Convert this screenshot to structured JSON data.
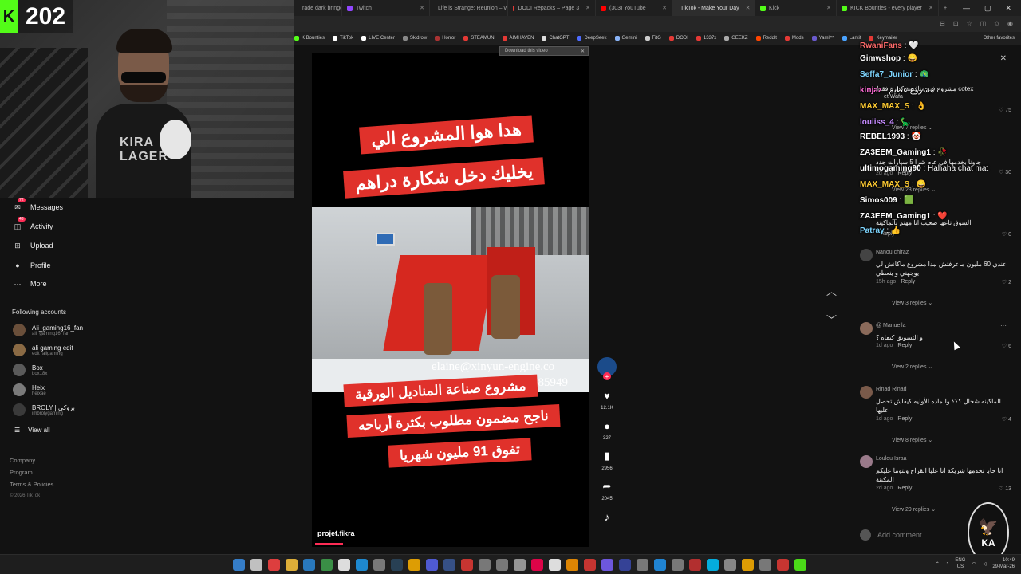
{
  "stream": {
    "viewer_count": "202",
    "shirt_text": "KIRA LAGER"
  },
  "browser": {
    "tabs": [
      {
        "label": "rade dark bringe",
        "color": "#6b8bd6",
        "active": false
      },
      {
        "label": "Twitch",
        "color": "#9146ff",
        "active": false
      },
      {
        "label": "Life is Strange: Reunion – v1",
        "color": "#e05b9a",
        "active": false
      },
      {
        "label": "DODI Repacks – Page 3",
        "color": "#e53935",
        "active": false
      },
      {
        "label": "(303) YouTube",
        "color": "#ff0000",
        "active": false
      },
      {
        "label": "TikTok - Make Your Day",
        "color": "#ffffff",
        "active": true
      },
      {
        "label": "Kick",
        "color": "#53fc18",
        "active": false
      },
      {
        "label": "KICK Bounties - every player",
        "color": "#53fc18",
        "active": false
      }
    ],
    "new_tab": "+",
    "bookmarks": [
      {
        "label": "K Bounties",
        "color": "#53fc18"
      },
      {
        "label": "TikTok",
        "color": "#ffffff"
      },
      {
        "label": "LIVE Center",
        "color": "#ffffff"
      },
      {
        "label": "Skidrow",
        "color": "#888888"
      },
      {
        "label": "Horror",
        "color": "#aa3333"
      },
      {
        "label": "STEAMUN",
        "color": "#e53935"
      },
      {
        "label": "AIMHAVEN",
        "color": "#e53935"
      },
      {
        "label": "ChatGPT",
        "color": "#dddddd"
      },
      {
        "label": "DeepSeek",
        "color": "#4d6bfe"
      },
      {
        "label": "Gemini",
        "color": "#8ab4f8"
      },
      {
        "label": "FitG",
        "color": "#cccccc"
      },
      {
        "label": "DODI",
        "color": "#e53935"
      },
      {
        "label": "1337x",
        "color": "#e53935"
      },
      {
        "label": "GEEKZ",
        "color": "#aaaaaa"
      },
      {
        "label": "Reddit",
        "color": "#ff4500"
      },
      {
        "label": "Mods",
        "color": "#e53935"
      },
      {
        "label": "Yaml™",
        "color": "#6a5acd"
      },
      {
        "label": "Larkit",
        "color": "#4aa3ff"
      },
      {
        "label": "Keymailer",
        "color": "#e53935"
      }
    ],
    "other_bookmarks": "Other favorites"
  },
  "sidebar": {
    "nav": [
      {
        "label": "Messages",
        "badge": "72",
        "icon": "✉"
      },
      {
        "label": "Activity",
        "badge": "43",
        "icon": "◫"
      },
      {
        "label": "Upload",
        "badge": "",
        "icon": "⊞"
      },
      {
        "label": "Profile",
        "badge": "",
        "icon": "●"
      },
      {
        "label": "More",
        "badge": "",
        "icon": "···"
      }
    ],
    "following_title": "Following accounts",
    "accounts": [
      {
        "name": "Ali_gaming16_fan",
        "handle": "ali_gaming16_fan"
      },
      {
        "name": "ali gaming edit",
        "handle": "edit_aligaming"
      },
      {
        "name": "Box",
        "handle": "box18x"
      },
      {
        "name": "Heix",
        "handle": "heixae"
      },
      {
        "name": "BROLY | بروكي",
        "handle": "imbrolygaming"
      }
    ],
    "view_all": "View all",
    "footer": [
      "Company",
      "Program",
      "Terms & Policies"
    ],
    "copyright": "© 2026 TikTok"
  },
  "video": {
    "download_bar": "Download this video",
    "caption_1": "هدا هوا المشروع الي",
    "caption_2": "يخليك دخل شكارة دراهم",
    "email": "elaine@xinyun-engine.co",
    "phone": "685949",
    "caption_3": "مشروع صناعة المناديل الورقية",
    "caption_4": "ناجح مضمون مطلوب بكثرة أرباحه",
    "caption_5": "تفوق 91 مليون شهريا",
    "author": "projet.fikra",
    "progress_fraction": 0.1
  },
  "actions": {
    "likes": "12.1K",
    "comments": "327",
    "saves": "2956",
    "shares": "2045"
  },
  "comments": [
    {
      "name": "Nanou chiraz",
      "text": "عندي 60 مليون ماعرفتش نبدا مشروع ماكانش لي يوجهني و ينعطي",
      "time": "15h ago",
      "likes": "2",
      "replies": "View 3 replies"
    },
    {
      "name": "@ Manuella",
      "text": "و التسويق كيفاه ؟",
      "time": "1d ago",
      "likes": "6",
      "replies": "View 2 replies"
    },
    {
      "name": "Rinad Rinad",
      "text": "الماكينه شحال ؟؟؟ والماده الأوليه كيفاش تحصل عليها",
      "time": "1d ago",
      "likes": "4",
      "replies": "View 8 replies"
    },
    {
      "name": "Loulou Israa",
      "text": "انا حابا نخدمها شريكة انا عليا القراج ونتوما عليكم المكينة",
      "time": "2d ago",
      "likes": "13",
      "replies": "View 29 replies"
    }
  ],
  "reply_label": "Reply",
  "add_comment_placeholder": "Add comment...",
  "chat": [
    {
      "user": "RwaniFans",
      "msg": " : 🤍",
      "color": "#ff6b6b"
    },
    {
      "user": "Gimwshop",
      "msg": " : 😄",
      "color": "#ffffff"
    },
    {
      "user": "Seffa7_Junior",
      "msg": " : 🦚",
      "color": "#7fd6ff"
    },
    {
      "user": "kinjaz",
      "msg": " : مشروع عظيم",
      "color": "#ff6bd6"
    },
    {
      "user": "MAX_MAX_S",
      "msg": " : 👌",
      "color": "#ffcc33"
    },
    {
      "user": "louiiss_4",
      "msg": " : 🦕",
      "color": "#c58bff"
    },
    {
      "user": "REBEL1993",
      "msg": " : 🤡",
      "color": "#ffffff"
    },
    {
      "user": "ZA3EEM_Gaming1",
      "msg": " : 🥀",
      "color": "#ffffff"
    },
    {
      "user": "ultimogaming90",
      "msg": " : Hahaha chat mat",
      "color": "#ffffff"
    },
    {
      "user": "MAX_MAX_S",
      "msg": " : 😄",
      "color": "#ffcc33"
    },
    {
      "user": "Simos009",
      "msg": " : 🟩",
      "color": "#ffffff"
    },
    {
      "user": "ZA3EEM_Gaming1",
      "msg": " : ❤️",
      "color": "#ffffff"
    },
    {
      "user": "Patray",
      "msg": " : 👍",
      "color": "#7fd6ff"
    }
  ],
  "chat_bg": {
    "c1_text": "cotex مشروع فيه منافسة كبيرة فقط",
    "c1_sub": "et Wafa",
    "c1_likes": "75",
    "c1_replies": "View 7 replies",
    "c2_text": "جاونا بخدمها في عام شرا 5 سيارات جدد",
    "c2_time": "2d ago",
    "c2_likes": "30",
    "c2_replies": "View 23 replies",
    "c3_text": "السوق تاعها صعيب انا مهتم بالماكينة",
    "c3_likes": "0"
  },
  "taskbar": {
    "icons": [
      "#3a8ee6",
      "#dddddd",
      "#ff4444",
      "#ffc83d",
      "#2b88d8",
      "#3fa34d",
      "#ffffff",
      "#1e9cf0",
      "#888888",
      "#2a475e",
      "#ffb400",
      "#5865f2",
      "#3b5998",
      "#e53935",
      "#888888",
      "#888888",
      "#aaaaaa",
      "#ff0050",
      "#ffffff",
      "#ff9800",
      "#e53935",
      "#7b61ff",
      "#3949ab",
      "#888888",
      "#2196f3",
      "#888888",
      "#cc3333",
      "#00c6ff",
      "#999999",
      "#ffb300",
      "#888888",
      "#e53935",
      "#53fc18"
    ],
    "lang_top": "ENG",
    "lang_bottom": "US",
    "time": "10:49",
    "date": "29-Mar-26"
  }
}
